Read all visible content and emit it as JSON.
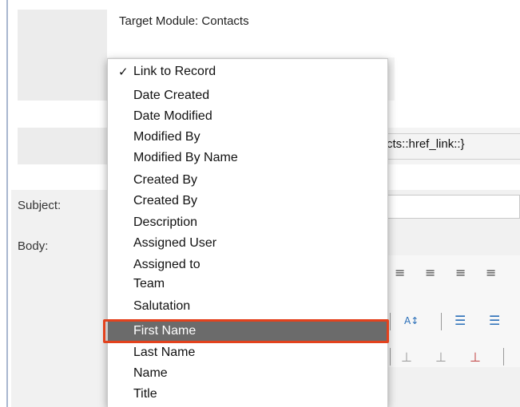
{
  "form": {
    "target_module": "Target Module: Contacts",
    "href_value": "cts::href_link::}",
    "subject_label": "Subject:",
    "body_label": "Body:"
  },
  "dropdown": {
    "items": [
      {
        "label": "Link to Record",
        "checked": true
      },
      {
        "label": "Date Created"
      },
      {
        "label": "Date Modified"
      },
      {
        "label": "Modified By"
      },
      {
        "label": "Modified By Name"
      },
      {
        "label": "Created By"
      },
      {
        "label": "Created By"
      },
      {
        "label": "Description"
      },
      {
        "label": "Assigned User"
      },
      {
        "label": "Assigned to"
      },
      {
        "label": "Team"
      },
      {
        "label": "Salutation"
      },
      {
        "label": "First Name",
        "highlighted": true
      },
      {
        "label": "Last Name"
      },
      {
        "label": "Name"
      },
      {
        "label": "Title"
      }
    ]
  },
  "toolbar": {
    "icons": [
      "align-left-icon",
      "align-center-icon",
      "align-right-icon",
      "align-justify-icon",
      "color-icon",
      "bullet-list-icon",
      "numbered-list-icon",
      "table-row-icon",
      "table-col-icon",
      "table-delete-icon"
    ]
  },
  "colors": {
    "highlight": "#6b6b6b",
    "callout": "#e3421d"
  }
}
